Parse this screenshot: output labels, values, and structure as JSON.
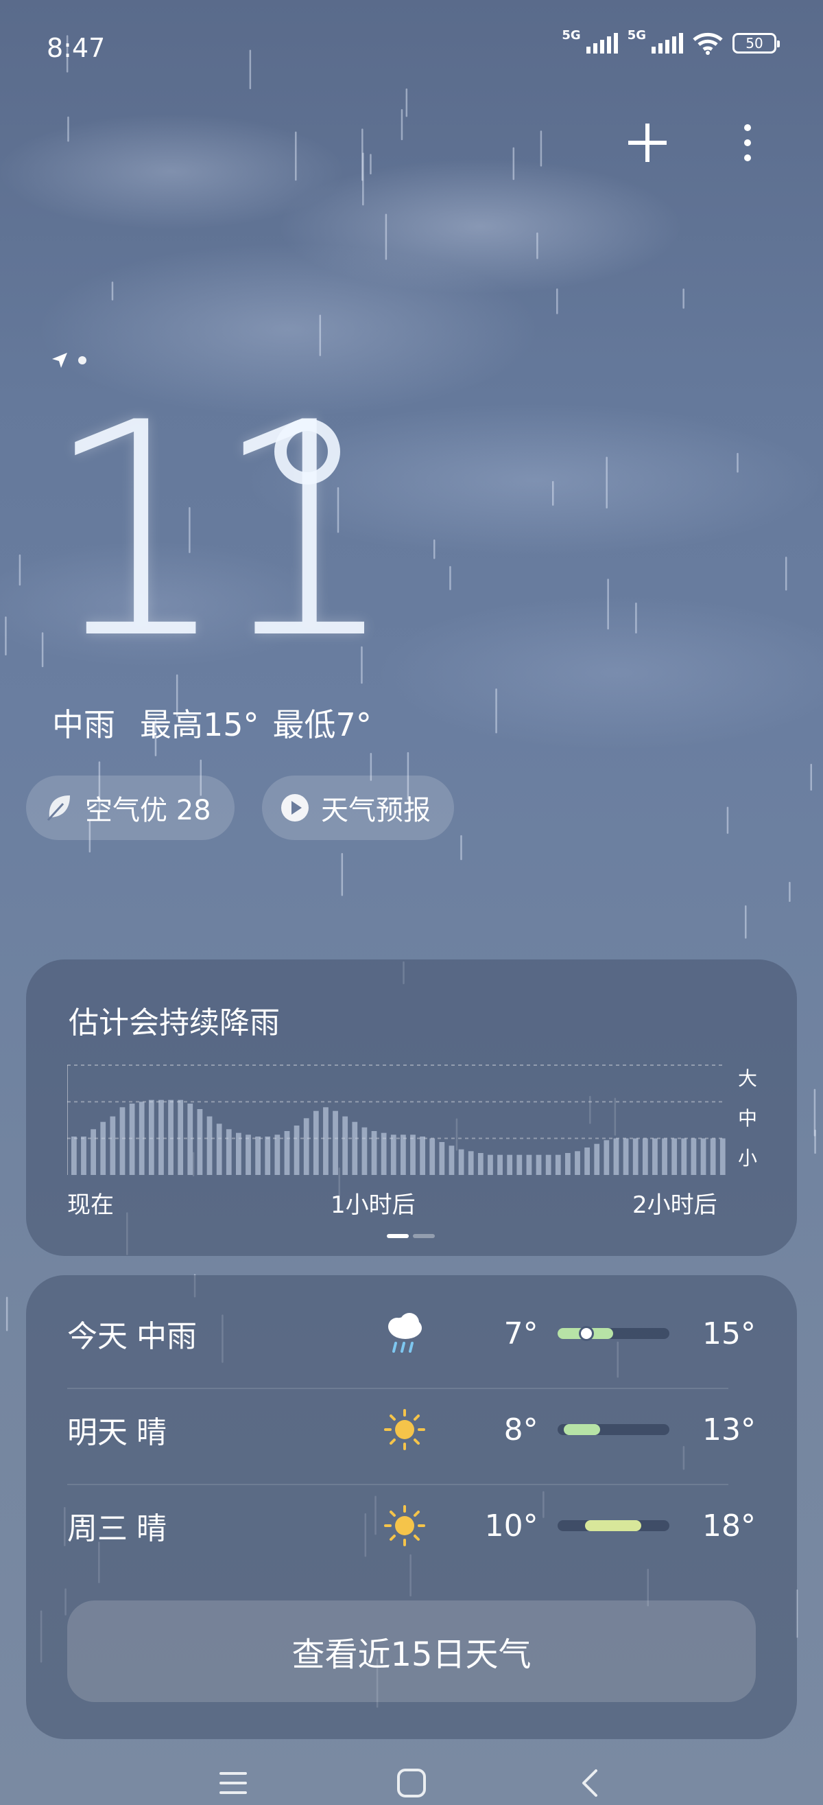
{
  "status_bar": {
    "time": "8:47",
    "net1": "5G",
    "net2": "5G",
    "battery": "50"
  },
  "actions": {
    "add_icon": "plus-icon",
    "more_icon": "more-vertical-icon"
  },
  "current": {
    "temperature": "11",
    "condition": "中雨",
    "high": "最高15°",
    "low": "最低7°"
  },
  "chips": {
    "air_quality": "空气优 28",
    "forecast_video": "天气预报"
  },
  "rain_card": {
    "title": "估计会持续降雨",
    "levels": [
      "大",
      "中",
      "小"
    ],
    "time_labels": [
      "现在",
      "1小时后",
      "2小时后"
    ]
  },
  "chart_data": {
    "type": "bar",
    "title": "估计会持续降雨",
    "x_labels": [
      "现在",
      "1小时后",
      "2小时后"
    ],
    "y_levels": [
      "小",
      "中",
      "大"
    ],
    "ylim": [
      0,
      3
    ],
    "values": [
      1.05,
      1.05,
      1.25,
      1.45,
      1.6,
      1.85,
      1.95,
      2.0,
      2.05,
      2.05,
      2.05,
      2.05,
      1.95,
      1.8,
      1.6,
      1.4,
      1.25,
      1.15,
      1.1,
      1.05,
      1.05,
      1.1,
      1.2,
      1.35,
      1.55,
      1.75,
      1.85,
      1.75,
      1.6,
      1.45,
      1.3,
      1.2,
      1.15,
      1.1,
      1.1,
      1.1,
      1.05,
      1.0,
      0.9,
      0.8,
      0.7,
      0.65,
      0.6,
      0.55,
      0.55,
      0.55,
      0.55,
      0.55,
      0.55,
      0.55,
      0.55,
      0.6,
      0.65,
      0.75,
      0.85,
      0.95,
      1.0,
      1.0,
      1.0,
      1.0,
      1.0,
      1.0,
      1.0,
      1.0,
      1.0,
      1.0,
      1.0,
      1.0
    ]
  },
  "forecast": [
    {
      "day": "今天",
      "condition": "中雨",
      "icon": "cloud-rain-icon",
      "low": "7°",
      "high": "15°",
      "bar_start": 0.0,
      "bar_end": 0.5,
      "bar_color": "#b7e3a6",
      "marker": 0.26
    },
    {
      "day": "明天",
      "condition": "晴",
      "icon": "sun-icon",
      "low": "8°",
      "high": "13°",
      "bar_start": 0.06,
      "bar_end": 0.38,
      "bar_color": "#b7e3a6"
    },
    {
      "day": "周三",
      "condition": "晴",
      "icon": "sun-icon",
      "low": "10°",
      "high": "18°",
      "bar_start": 0.25,
      "bar_end": 0.75,
      "bar_color": "#d8e79a"
    }
  ],
  "cta": {
    "label": "查看近15日天气"
  },
  "nav": {
    "menu_icon": "menu-icon",
    "home_icon": "home-icon",
    "back_icon": "back-icon"
  }
}
